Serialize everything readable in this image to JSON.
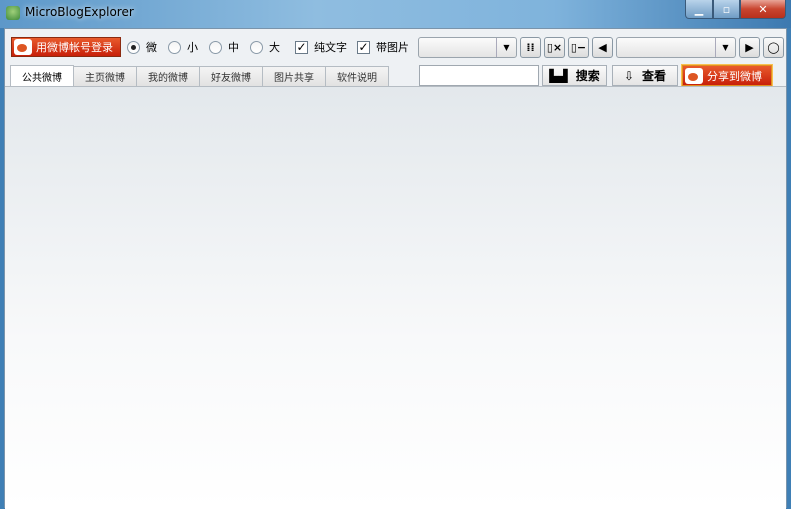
{
  "window": {
    "title": "MicroBlogExplorer",
    "minimize": "▁",
    "maximize": "▫",
    "close": "✕"
  },
  "toolbar": {
    "login_label": "用微博帐号登录",
    "sizes": [
      {
        "label": "微",
        "selected": true
      },
      {
        "label": "小",
        "selected": false
      },
      {
        "label": "中",
        "selected": false
      },
      {
        "label": "大",
        "selected": false
      }
    ],
    "text_only": {
      "label": "纯文字",
      "checked": true
    },
    "with_image": {
      "label": "带图片",
      "checked": true
    },
    "combo1_value": "",
    "combo2_value": ""
  },
  "tabs": [
    "公共微博",
    "主页微博",
    "我的微博",
    "好友微博",
    "图片共享",
    "软件说明"
  ],
  "search": {
    "value": "",
    "search_label": "搜索",
    "view_label": "查看",
    "share_label": "分享到微博"
  }
}
